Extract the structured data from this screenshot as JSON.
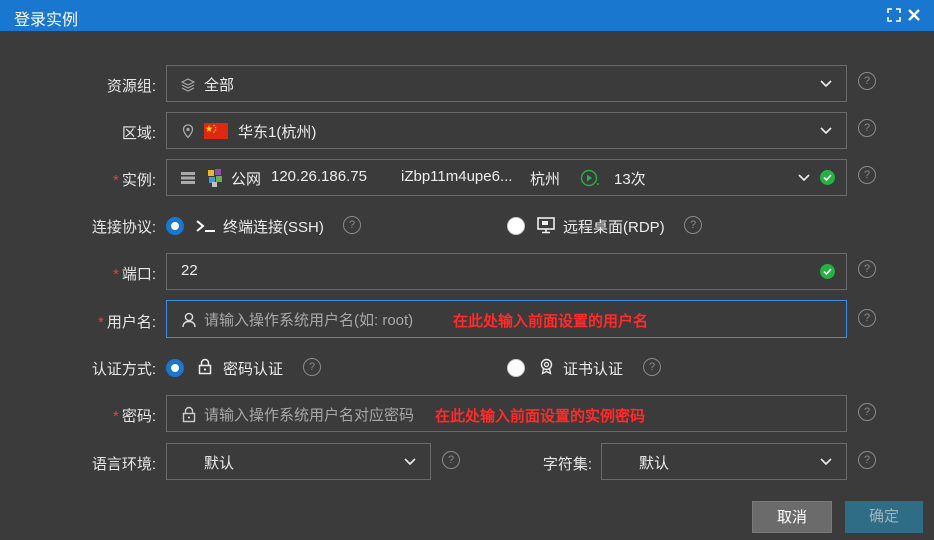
{
  "window": {
    "title": "登录实例"
  },
  "fields": {
    "resource_group": {
      "label": "资源组:",
      "value": "全部"
    },
    "region": {
      "label": "区域:",
      "value": "华东1(杭州)"
    },
    "instance": {
      "label": "实例:",
      "net": "公网",
      "ip": "120.26.186.75",
      "id": "iZbp11m4upe6...",
      "city": "杭州",
      "count": "13次"
    },
    "protocol": {
      "label": "连接协议:",
      "option1": "终端连接(SSH)",
      "option2": "远程桌面(RDP)"
    },
    "port": {
      "label": "端口:",
      "value": "22"
    },
    "username": {
      "label": "用户名:",
      "placeholder": "请输入操作系统用户名(如: root)",
      "annotation": "在此处输入前面设置的用户名"
    },
    "auth": {
      "label": "认证方式:",
      "option1": "密码认证",
      "option2": "证书认证"
    },
    "password": {
      "label": "密码:",
      "placeholder": "请输入操作系统用户名对应密码",
      "annotation": "在此处输入前面设置的实例密码"
    },
    "locale": {
      "label": "语言环境:",
      "value": "默认"
    },
    "charset": {
      "label": "字符集:",
      "value": "默认"
    }
  },
  "buttons": {
    "cancel": "取消",
    "confirm": "确定"
  },
  "colors": {
    "titlebar": "#1a77cf",
    "background": "#3b3b3b",
    "required": "#e0463c",
    "annotation": "#ff2a2a",
    "success": "#27b043"
  }
}
